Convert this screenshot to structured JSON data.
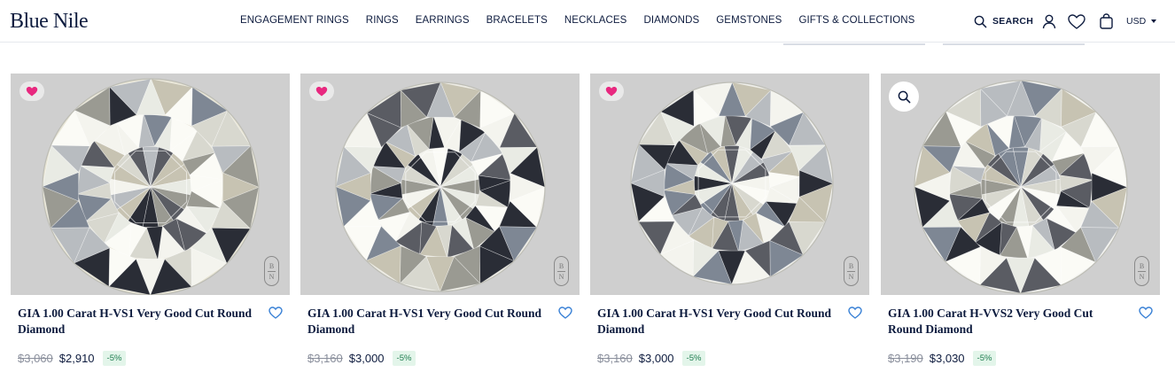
{
  "brand": {
    "logo": "Blue Nile"
  },
  "nav": [
    "ENGAGEMENT RINGS",
    "RINGS",
    "EARRINGS",
    "BRACELETS",
    "NECKLACES",
    "DIAMONDS",
    "GEMSTONES",
    "GIFTS & COLLECTIONS"
  ],
  "utility": {
    "search_label": "SEARCH",
    "search_icon": "search-icon",
    "account_icon": "user-icon",
    "wishlist_icon": "heart-icon",
    "bag_icon": "shopping-bag-icon",
    "currency": "USD"
  },
  "colors": {
    "brand_navy": "#0d1b3e",
    "wishlist_pink": "#e8287f",
    "heart_outline": "#3b82d6",
    "discount_green": "#1e7d4f"
  },
  "products": [
    {
      "title": "GIA 1.00 Carat H-VS1 Very Good Cut Round Diamond",
      "old_price": "$3,060",
      "price": "$2,910",
      "discount": "-5%",
      "badge": "wishlist-badge",
      "watermark": {
        "top": "B",
        "bottom": "N"
      }
    },
    {
      "title": "GIA 1.00 Carat H-VS1 Very Good Cut Round Diamond",
      "old_price": "$3,160",
      "price": "$3,000",
      "discount": "-5%",
      "badge": "wishlist-badge",
      "watermark": {
        "top": "B",
        "bottom": "N"
      }
    },
    {
      "title": "GIA 1.00 Carat H-VS1 Very Good Cut Round Diamond",
      "old_price": "$3,160",
      "price": "$3,000",
      "discount": "-5%",
      "badge": "wishlist-badge",
      "watermark": {
        "top": "B",
        "bottom": "N"
      }
    },
    {
      "title": "GIA 1.00 Carat H-VVS2 Very Good Cut Round Diamond",
      "old_price": "$3,190",
      "price": "$3,030",
      "discount": "-5%",
      "badge": "zoom-badge",
      "watermark": {
        "top": "B",
        "bottom": "N"
      }
    }
  ]
}
